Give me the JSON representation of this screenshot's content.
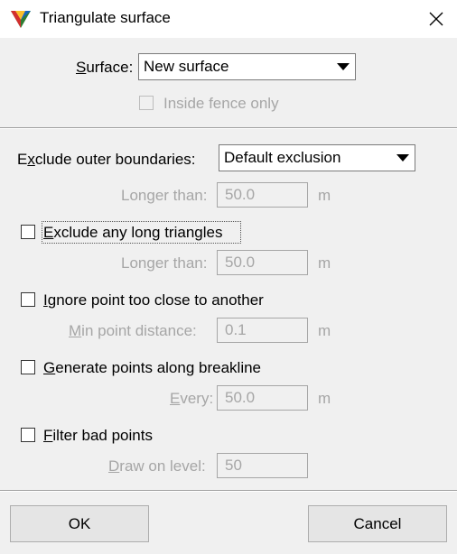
{
  "window": {
    "title": "Triangulate surface",
    "app_icon": "triangle-surface-icon",
    "close_icon": "close-icon"
  },
  "surface": {
    "label": "Surface:",
    "value": "New surface"
  },
  "inside_fence": {
    "label": "Inside fence only",
    "checked": false,
    "enabled": false
  },
  "exclude_outer": {
    "label": "Exclude outer boundaries:",
    "value": "Default exclusion",
    "longer_label": "Longer than:",
    "longer_value": "50.0",
    "unit": "m"
  },
  "exclude_long": {
    "label": "Exclude any long triangles",
    "checked": false,
    "longer_label": "Longer than:",
    "longer_value": "50.0",
    "unit": "m"
  },
  "ignore_close": {
    "label": "Ignore point too close to another",
    "checked": false,
    "min_label": "Min point distance:",
    "min_value": "0.1",
    "unit": "m"
  },
  "generate_points": {
    "label": "Generate points along breakline",
    "checked": false,
    "every_label": "Every:",
    "every_value": "50.0",
    "unit": "m"
  },
  "filter_bad": {
    "label": "Filter bad points",
    "checked": false,
    "level_label": "Draw on level:",
    "level_value": "50"
  },
  "buttons": {
    "ok": "OK",
    "cancel": "Cancel"
  }
}
